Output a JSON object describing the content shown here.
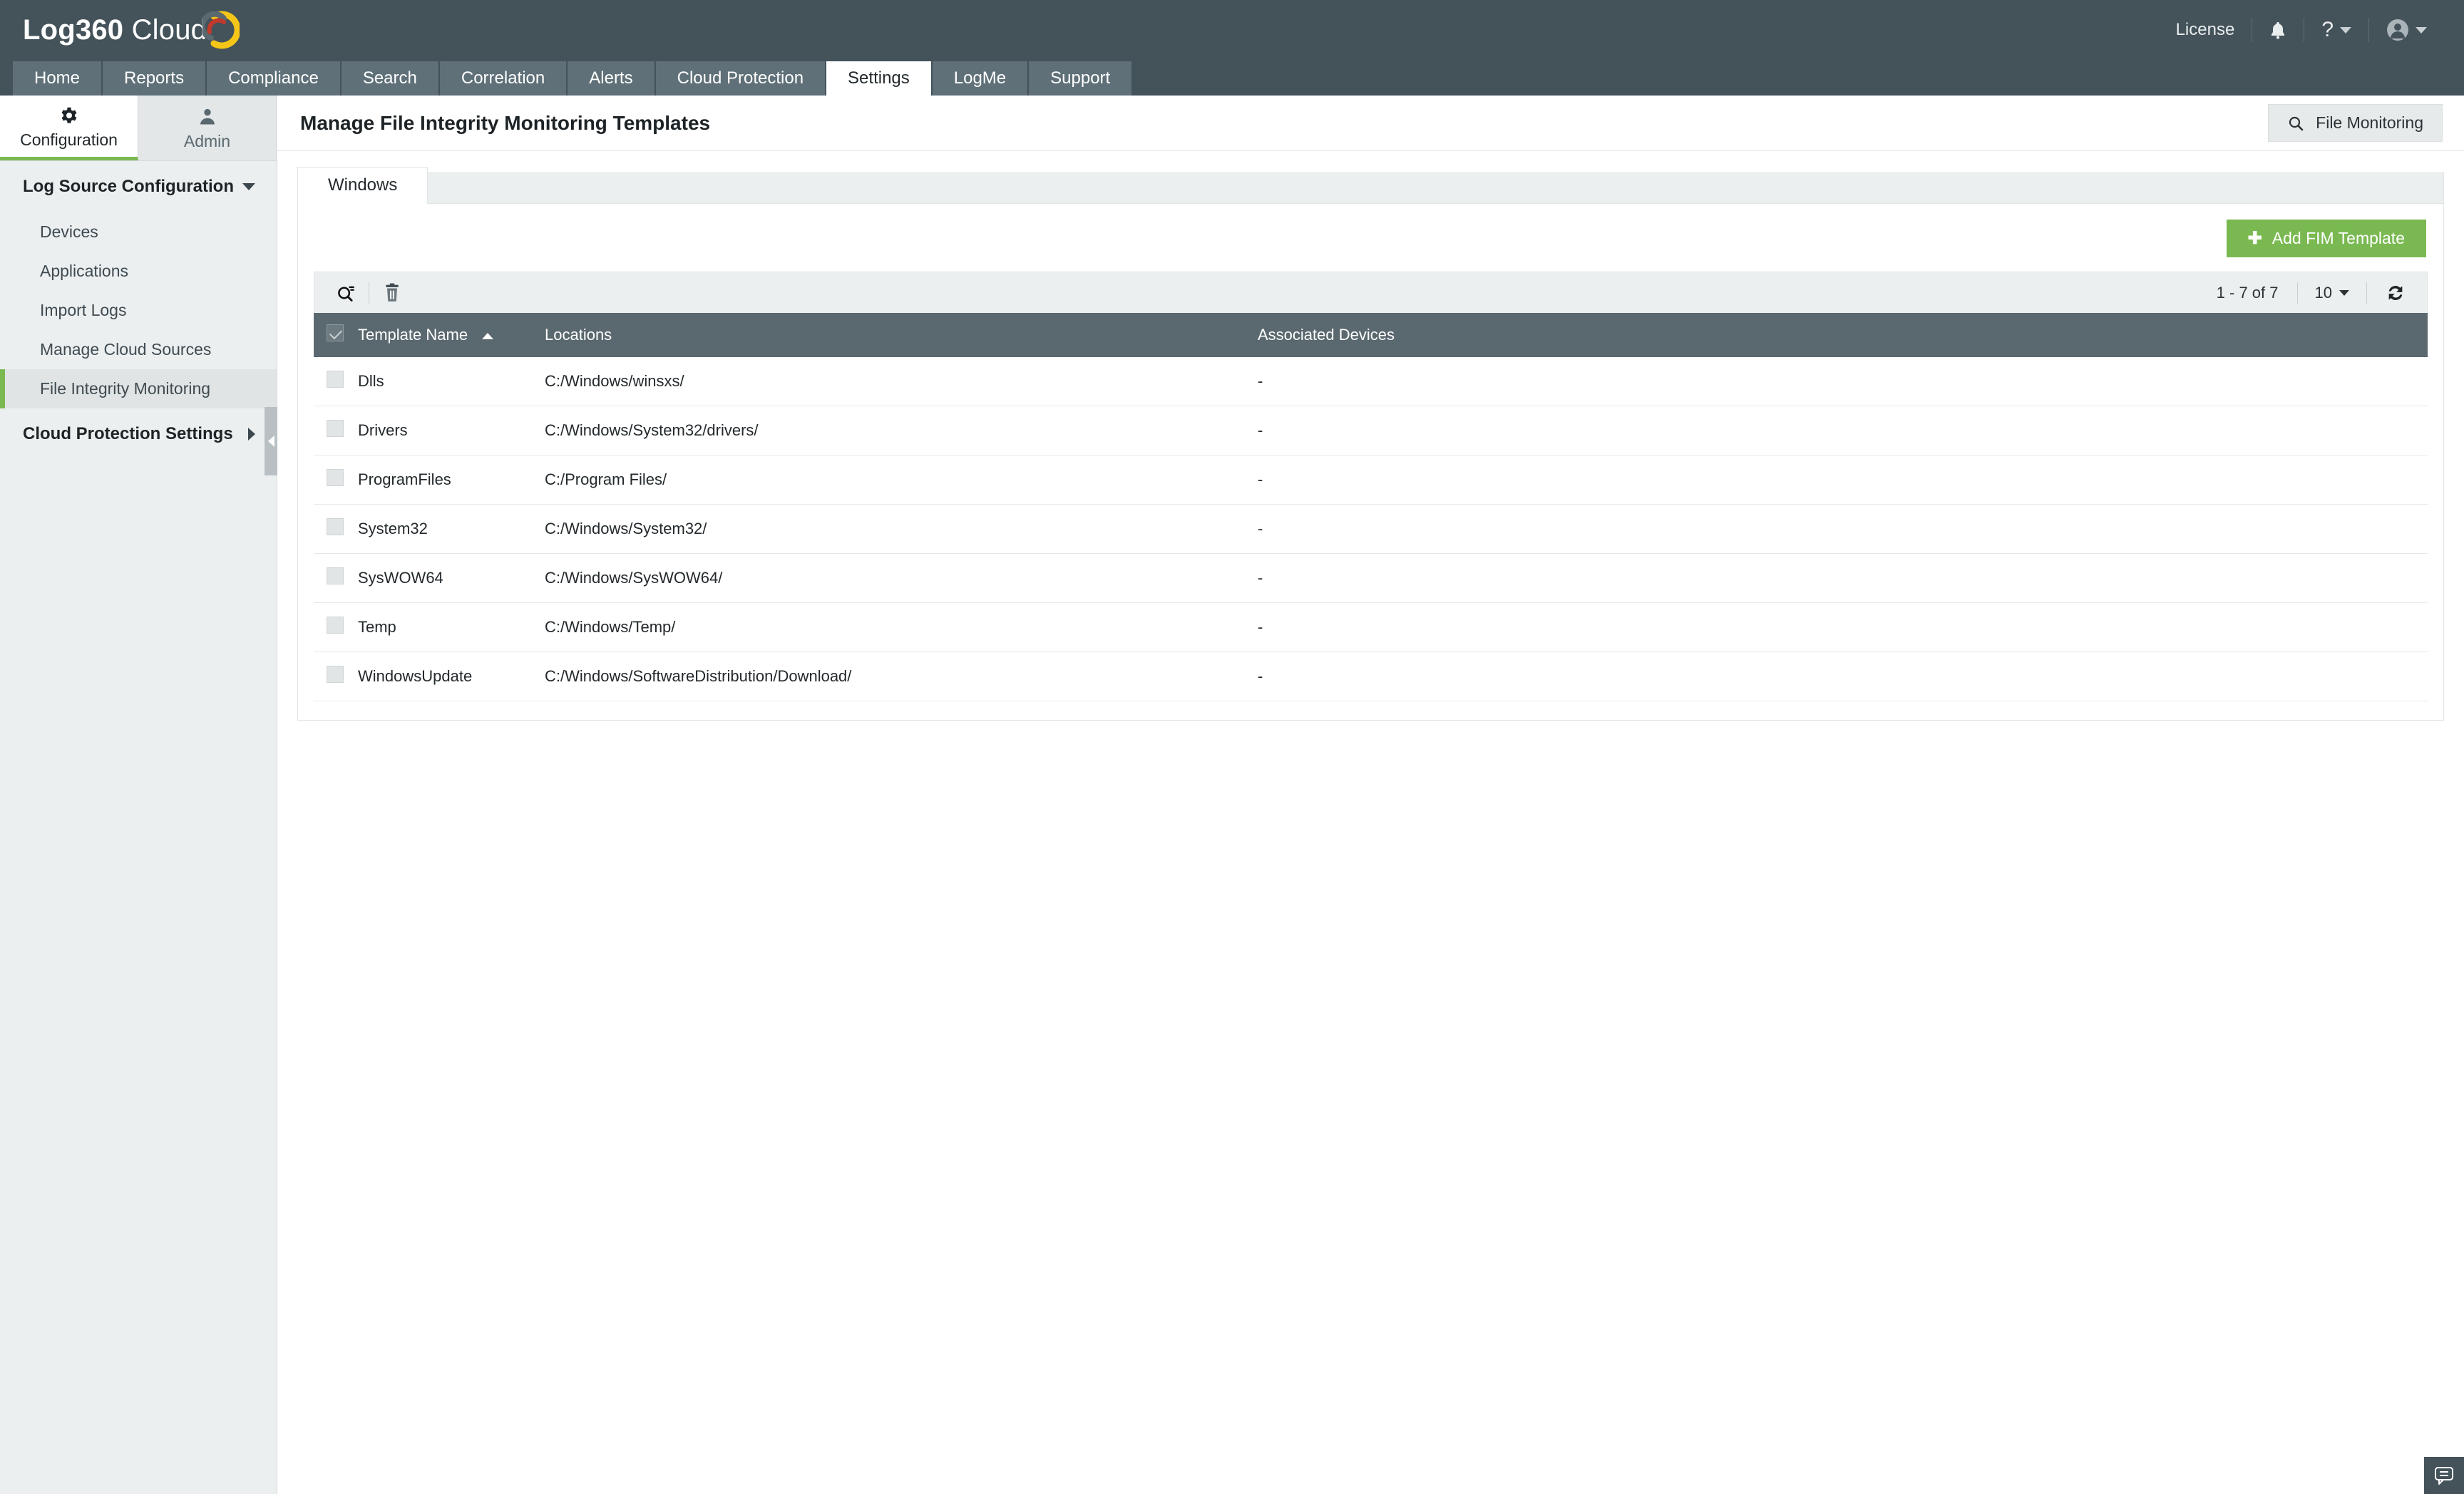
{
  "brand": {
    "name_bold": "Log360",
    "name_light": "Cloud",
    "accent_green": "#7ab951",
    "header_bg": "#44525a",
    "tab_bg": "#5f7078",
    "table_header_bg": "#5a686f"
  },
  "header": {
    "license_label": "License",
    "bell_icon": "bell-icon",
    "help_icon": "question-mark-icon",
    "user_icon": "user-avatar-icon"
  },
  "nav_tabs": [
    {
      "label": "Home",
      "active": false
    },
    {
      "label": "Reports",
      "active": false
    },
    {
      "label": "Compliance",
      "active": false
    },
    {
      "label": "Search",
      "active": false
    },
    {
      "label": "Correlation",
      "active": false
    },
    {
      "label": "Alerts",
      "active": false
    },
    {
      "label": "Cloud Protection",
      "active": false
    },
    {
      "label": "Settings",
      "active": true
    },
    {
      "label": "LogMe",
      "active": false
    },
    {
      "label": "Support",
      "active": false
    }
  ],
  "sub_tabs": [
    {
      "label": "Configuration",
      "icon": "gear-icon",
      "active": true
    },
    {
      "label": "Admin",
      "icon": "user-icon",
      "active": false
    }
  ],
  "sidebar": {
    "sections": [
      {
        "label": "Log Source Configuration",
        "expanded": true,
        "items": [
          {
            "label": "Devices",
            "selected": false
          },
          {
            "label": "Applications",
            "selected": false
          },
          {
            "label": "Import Logs",
            "selected": false
          },
          {
            "label": "Manage Cloud Sources",
            "selected": false
          },
          {
            "label": "File Integrity Monitoring",
            "selected": true
          }
        ]
      },
      {
        "label": "Cloud Protection Settings",
        "expanded": false,
        "items": []
      }
    ]
  },
  "page": {
    "title": "Manage File Integrity Monitoring Templates",
    "file_monitoring_button": "File Monitoring",
    "file_monitoring_icon": "search-icon"
  },
  "content_tabs": [
    {
      "label": "Windows",
      "active": true
    }
  ],
  "actions": {
    "add_template_label": "Add FIM Template",
    "add_template_icon": "plus-icon"
  },
  "toolbar": {
    "search_icon": "search-filter-icon",
    "delete_icon": "trash-icon",
    "record_range": "1 - 7 of 7",
    "page_size": "10",
    "refresh_icon": "refresh-icon"
  },
  "table": {
    "columns": [
      {
        "key": "checkbox",
        "label": ""
      },
      {
        "key": "name",
        "label": "Template Name",
        "sort": "asc"
      },
      {
        "key": "locations",
        "label": "Locations"
      },
      {
        "key": "devices",
        "label": "Associated Devices"
      }
    ],
    "rows": [
      {
        "name": "Dlls",
        "locations": "C:/Windows/winsxs/",
        "devices": "-"
      },
      {
        "name": "Drivers",
        "locations": "C:/Windows/System32/drivers/",
        "devices": "-"
      },
      {
        "name": "ProgramFiles",
        "locations": "C:/Program Files/",
        "devices": "-"
      },
      {
        "name": "System32",
        "locations": "C:/Windows/System32/",
        "devices": "-"
      },
      {
        "name": "SysWOW64",
        "locations": "C:/Windows/SysWOW64/",
        "devices": "-"
      },
      {
        "name": "Temp",
        "locations": "C:/Windows/Temp/",
        "devices": "-"
      },
      {
        "name": "WindowsUpdate",
        "locations": "C:/Windows/SoftwareDistribution/Download/",
        "devices": "-"
      }
    ]
  },
  "chat": {
    "icon": "chat-bubble-icon"
  }
}
